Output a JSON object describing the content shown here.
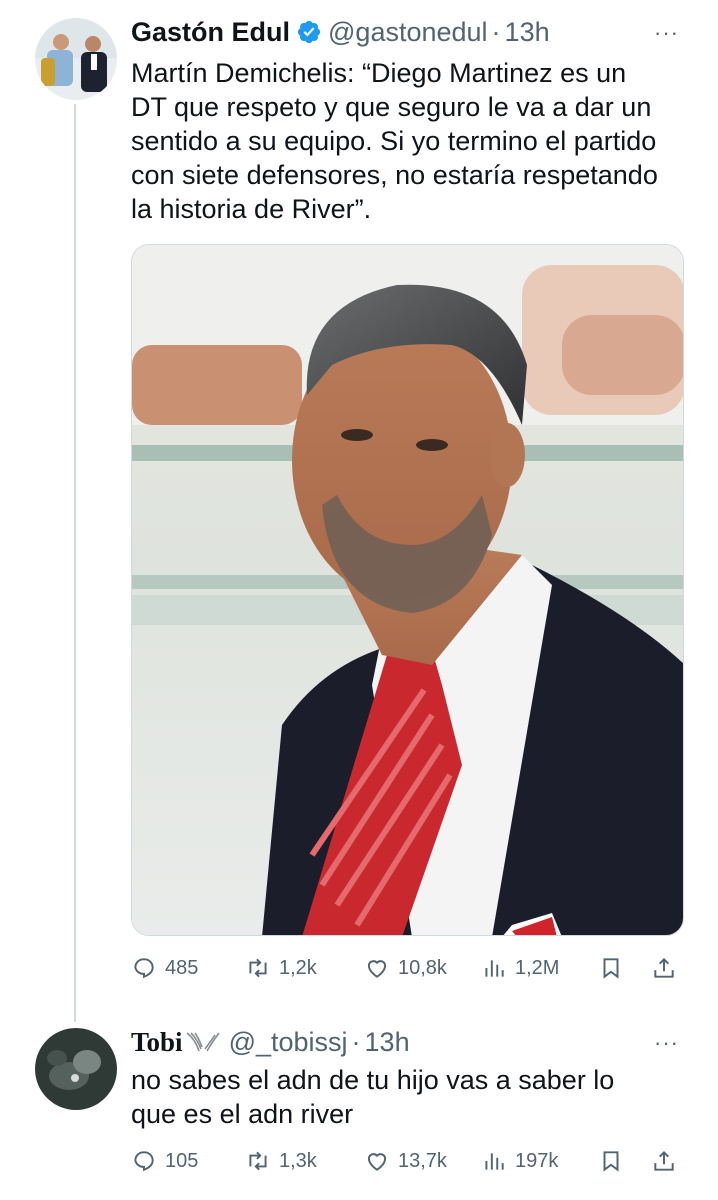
{
  "tweet": {
    "author_name": "Gastón Edul",
    "handle": "@gastonedul",
    "separator": "·",
    "time": "13h",
    "more_icon": "···",
    "text": "Martín Demichelis: “Diego Martinez es un\nDT que respeto y que seguro le va a dar un\nsentido a su equipo. Si yo termino el partido\ncon siete defensores, no estaría respetando\nla historia de River”.",
    "stats": {
      "replies": "485",
      "reposts": "1,2k",
      "likes": "10,8k",
      "views": "1,2M"
    },
    "colors": {
      "verified": "#1d9bf0",
      "muted": "#536471"
    }
  },
  "reply": {
    "author_name": "Tobi",
    "handle": "@_tobissj",
    "separator": "·",
    "time": "13h",
    "more_icon": "···",
    "text": "no sabes el adn de tu hijo vas a saber lo\nque es el adn river",
    "stats": {
      "replies": "105",
      "reposts": "1,3k",
      "likes": "13,7k",
      "views": "197k"
    }
  }
}
